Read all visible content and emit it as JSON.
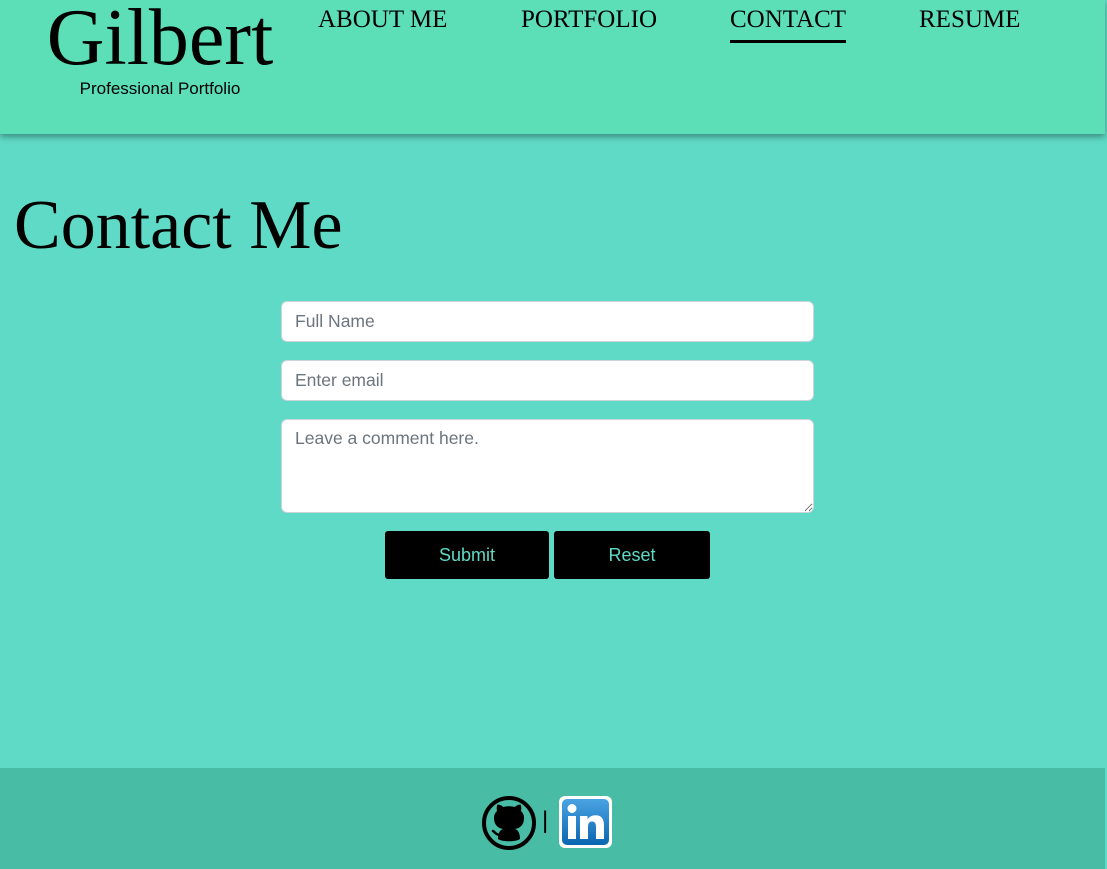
{
  "header": {
    "brand_name": "Gilbert",
    "brand_tagline": "Professional Portfolio",
    "background": "#5cdfb6"
  },
  "nav": {
    "items": [
      {
        "label": "ABOUT ME",
        "active": false
      },
      {
        "label": "PORTFOLIO",
        "active": false
      },
      {
        "label": "CONTACT",
        "active": true
      },
      {
        "label": "RESUME",
        "active": false
      }
    ]
  },
  "main": {
    "title": "Contact Me",
    "background": "#5fdac6"
  },
  "form": {
    "name_placeholder": "Full Name",
    "name_value": "",
    "email_placeholder": "Enter email",
    "email_value": "",
    "comment_placeholder": "Leave a comment here.",
    "comment_value": "",
    "submit_label": "Submit",
    "reset_label": "Reset",
    "button_color": "#000000",
    "button_text_color": "#5fdac6"
  },
  "footer": {
    "separator": "|",
    "icons": [
      "github-icon",
      "linkedin-icon"
    ],
    "background": "#48bca4"
  }
}
